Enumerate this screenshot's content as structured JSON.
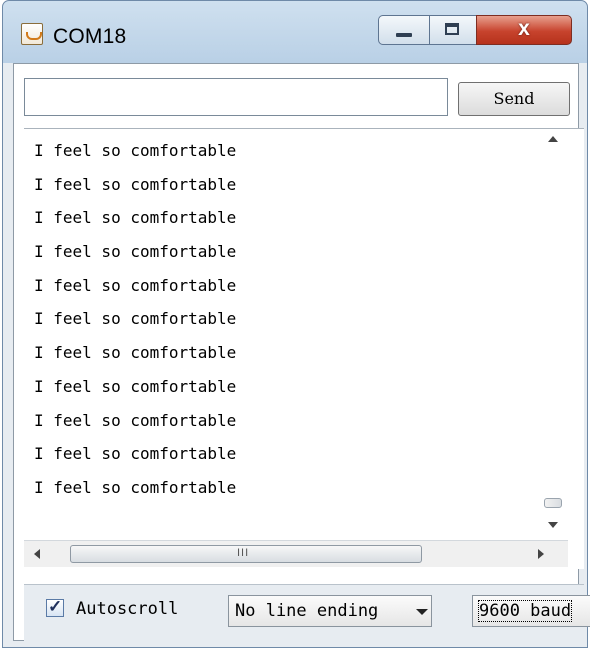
{
  "window": {
    "title": "COM18",
    "controls": {
      "minimize_icon": "minimize-icon",
      "maximize_icon": "maximize-icon",
      "close_icon": "close-icon",
      "close_glyph": "x"
    }
  },
  "send_bar": {
    "input_value": "",
    "send_label": "Send"
  },
  "output": {
    "lines": [
      "I feel so comfortable",
      "I feel so comfortable",
      "I feel so comfortable",
      "I feel so comfortable",
      "I feel so comfortable",
      "I feel so comfortable",
      "I feel so comfortable",
      "I feel so comfortable",
      "I feel so comfortable",
      "I feel so comfortable",
      "I feel so comfortable"
    ]
  },
  "scrollbar": {
    "grip": "III"
  },
  "footer": {
    "autoscroll_label": "Autoscroll",
    "autoscroll_checked": true,
    "line_ending_value": "No line ending",
    "baud_value": "9600 baud"
  },
  "colors": {
    "close_button": "#c7432d",
    "title_bar": "#b9d0e6"
  }
}
